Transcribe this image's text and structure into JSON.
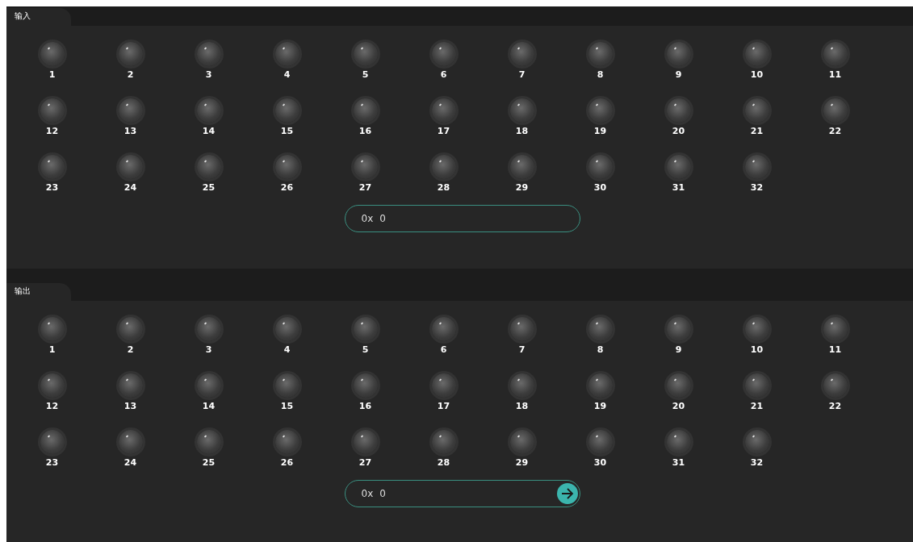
{
  "sections": [
    {
      "tab": {
        "label": "输入",
        "selected": true
      },
      "leds": [
        {
          "label": "1",
          "on": false
        },
        {
          "label": "2",
          "on": false
        },
        {
          "label": "3",
          "on": false
        },
        {
          "label": "4",
          "on": false
        },
        {
          "label": "5",
          "on": false
        },
        {
          "label": "6",
          "on": false
        },
        {
          "label": "7",
          "on": false
        },
        {
          "label": "8",
          "on": false
        },
        {
          "label": "9",
          "on": false
        },
        {
          "label": "10",
          "on": false
        },
        {
          "label": "11",
          "on": false
        },
        {
          "label": "12",
          "on": false
        },
        {
          "label": "13",
          "on": false
        },
        {
          "label": "14",
          "on": false
        },
        {
          "label": "15",
          "on": false
        },
        {
          "label": "16",
          "on": false
        },
        {
          "label": "17",
          "on": false
        },
        {
          "label": "18",
          "on": false
        },
        {
          "label": "19",
          "on": false
        },
        {
          "label": "20",
          "on": false
        },
        {
          "label": "21",
          "on": false
        },
        {
          "label": "22",
          "on": false
        },
        {
          "label": "23",
          "on": false
        },
        {
          "label": "24",
          "on": false
        },
        {
          "label": "25",
          "on": false
        },
        {
          "label": "26",
          "on": false
        },
        {
          "label": "27",
          "on": false
        },
        {
          "label": "28",
          "on": false
        },
        {
          "label": "29",
          "on": false
        },
        {
          "label": "30",
          "on": false
        },
        {
          "label": "31",
          "on": false
        },
        {
          "label": "32",
          "on": false
        }
      ],
      "field": {
        "kind": "display",
        "prefix": "0x",
        "value": "0"
      }
    },
    {
      "tab": {
        "label": "输出",
        "selected": true
      },
      "leds": [
        {
          "label": "1",
          "on": false
        },
        {
          "label": "2",
          "on": false
        },
        {
          "label": "3",
          "on": false
        },
        {
          "label": "4",
          "on": false
        },
        {
          "label": "5",
          "on": false
        },
        {
          "label": "6",
          "on": false
        },
        {
          "label": "7",
          "on": false
        },
        {
          "label": "8",
          "on": false
        },
        {
          "label": "9",
          "on": false
        },
        {
          "label": "10",
          "on": false
        },
        {
          "label": "11",
          "on": false
        },
        {
          "label": "12",
          "on": false
        },
        {
          "label": "13",
          "on": false
        },
        {
          "label": "14",
          "on": false
        },
        {
          "label": "15",
          "on": false
        },
        {
          "label": "16",
          "on": false
        },
        {
          "label": "17",
          "on": false
        },
        {
          "label": "18",
          "on": false
        },
        {
          "label": "19",
          "on": false
        },
        {
          "label": "20",
          "on": false
        },
        {
          "label": "21",
          "on": false
        },
        {
          "label": "22",
          "on": false
        },
        {
          "label": "23",
          "on": false
        },
        {
          "label": "24",
          "on": false
        },
        {
          "label": "25",
          "on": false
        },
        {
          "label": "26",
          "on": false
        },
        {
          "label": "27",
          "on": false
        },
        {
          "label": "28",
          "on": false
        },
        {
          "label": "29",
          "on": false
        },
        {
          "label": "30",
          "on": false
        },
        {
          "label": "31",
          "on": false
        },
        {
          "label": "32",
          "on": false
        }
      ],
      "field": {
        "kind": "submit",
        "prefix": "0x",
        "value": "0"
      }
    }
  ]
}
